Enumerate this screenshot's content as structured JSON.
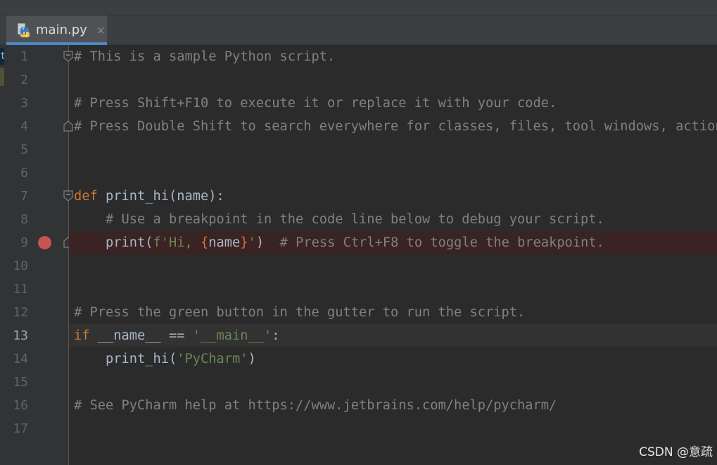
{
  "tab": {
    "filename": "main.py",
    "icon": "python-file-icon",
    "close_glyph": "×",
    "accent_color": "#4a88c7"
  },
  "edge": {
    "glyph": "t"
  },
  "colors": {
    "background": "#2b2b2b",
    "gutter": "#313335",
    "comment": "#808080",
    "keyword": "#cc7832",
    "string": "#6a8759",
    "text": "#a9b7c6",
    "breakpoint": "#c75450",
    "breakpoint_line": "#3a2323",
    "current_line": "#323232"
  },
  "editor": {
    "current_line": "13",
    "breakpoint_line": "9",
    "line_numbers": [
      "1",
      "2",
      "3",
      "4",
      "5",
      "6",
      "7",
      "8",
      "9",
      "10",
      "11",
      "12",
      "13",
      "14",
      "15",
      "16",
      "17"
    ],
    "lines": [
      [
        {
          "t": "comment",
          "v": "# This is a sample Python script."
        }
      ],
      [],
      [
        {
          "t": "comment",
          "v": "# Press Shift+F10 to execute it or replace it with your code."
        }
      ],
      [
        {
          "t": "comment",
          "v": "# Press Double Shift to search everywhere for classes, files, tool windows, actions, and settings."
        }
      ],
      [],
      [],
      [
        {
          "t": "kw",
          "v": "def "
        },
        {
          "t": "fn",
          "v": "print_hi"
        },
        {
          "t": "dflt",
          "v": "(name):"
        }
      ],
      [
        {
          "t": "comment",
          "v": "    # Use a breakpoint in the code line below to debug your script."
        }
      ],
      [
        {
          "t": "dflt",
          "v": "    print("
        },
        {
          "t": "str",
          "v": "f'Hi, "
        },
        {
          "t": "brace",
          "v": "{"
        },
        {
          "t": "dflt",
          "v": "name"
        },
        {
          "t": "brace",
          "v": "}"
        },
        {
          "t": "str",
          "v": "'"
        },
        {
          "t": "dflt",
          "v": ")  "
        },
        {
          "t": "comment",
          "v": "# Press Ctrl+F8 to toggle the breakpoint."
        }
      ],
      [],
      [],
      [
        {
          "t": "comment",
          "v": "# Press the green button in the gutter to run the script."
        }
      ],
      [
        {
          "t": "kw",
          "v": "if "
        },
        {
          "t": "dflt",
          "v": "__name__ == "
        },
        {
          "t": "str",
          "v": "'__main__'"
        },
        {
          "t": "dflt",
          "v": ":"
        }
      ],
      [
        {
          "t": "dflt",
          "v": "    print_hi("
        },
        {
          "t": "str",
          "v": "'PyCharm'"
        },
        {
          "t": "dflt",
          "v": ")"
        }
      ],
      [],
      [
        {
          "t": "comment",
          "v": "# See PyCharm help at https://www.jetbrains.com/help/pycharm/"
        }
      ],
      []
    ],
    "fold_markers": [
      "1",
      "4",
      "7",
      "9"
    ]
  },
  "watermark": "CSDN @意疏"
}
